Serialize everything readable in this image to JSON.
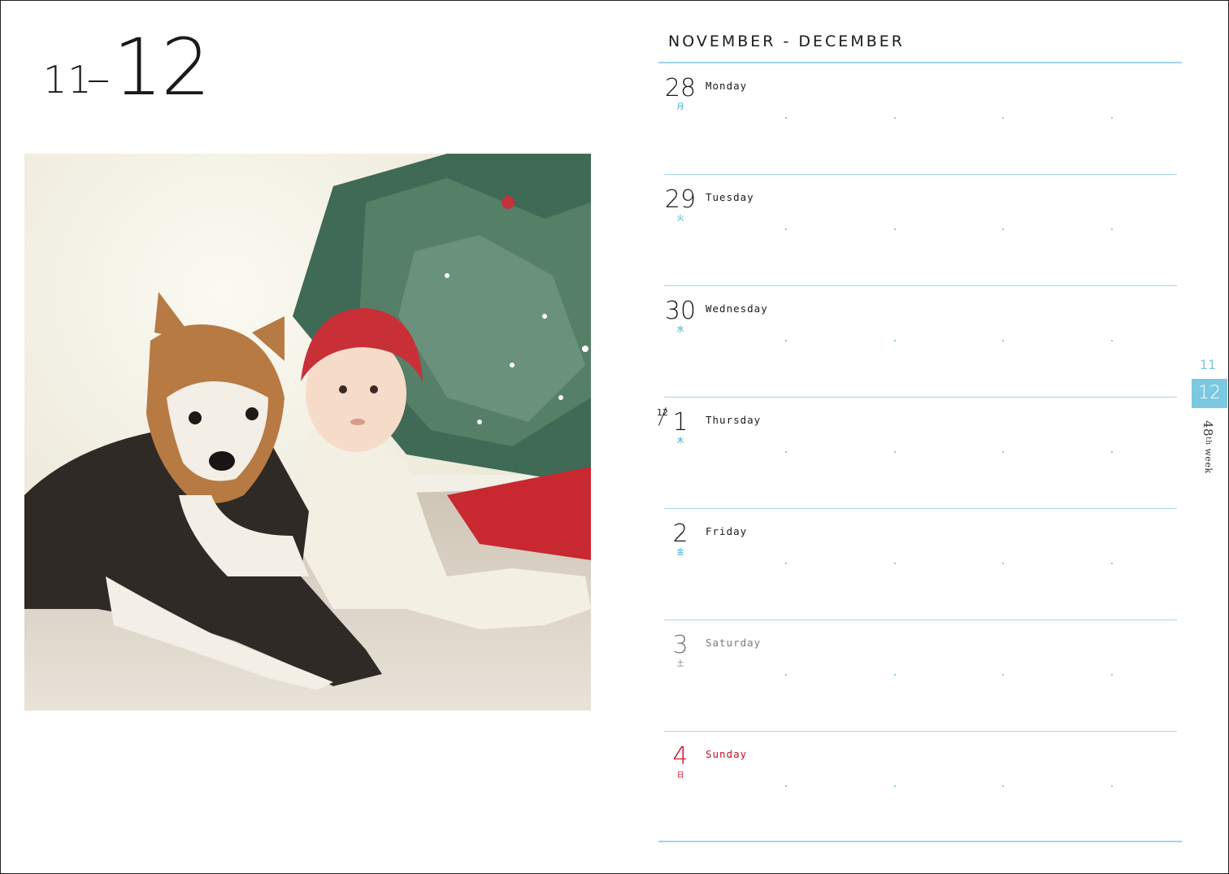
{
  "left_page": {
    "prev_month": "11",
    "current_month": "12",
    "photo_description_icon": "photo-dog-baby-christmas-tree"
  },
  "right_page": {
    "range_title": "NOVEMBER - DECEMBER",
    "days": [
      {
        "num": "28",
        "kanji": "月",
        "name": "Monday",
        "month_prefix": ""
      },
      {
        "num": "29",
        "kanji": "火",
        "name": "Tuesday",
        "month_prefix": ""
      },
      {
        "num": "30",
        "kanji": "水",
        "name": "Wednesday",
        "month_prefix": ""
      },
      {
        "num": "1",
        "kanji": "木",
        "name": "Thursday",
        "month_prefix": "12"
      },
      {
        "num": "2",
        "kanji": "金",
        "name": "Friday",
        "month_prefix": ""
      },
      {
        "num": "3",
        "kanji": "土",
        "name": "Saturday",
        "month_prefix": ""
      },
      {
        "num": "4",
        "kanji": "日",
        "name": "Sunday",
        "month_prefix": ""
      }
    ]
  },
  "side_tabs": {
    "prev": "11",
    "current": "12",
    "week_number": "48",
    "week_suffix": "th",
    "week_word": "week"
  },
  "colors": {
    "accent_blue": "#7cc8e0",
    "rule_blue": "#9fd6ea",
    "sunday_red": "#c8102e",
    "saturday_gray": "#7a7a7a"
  }
}
